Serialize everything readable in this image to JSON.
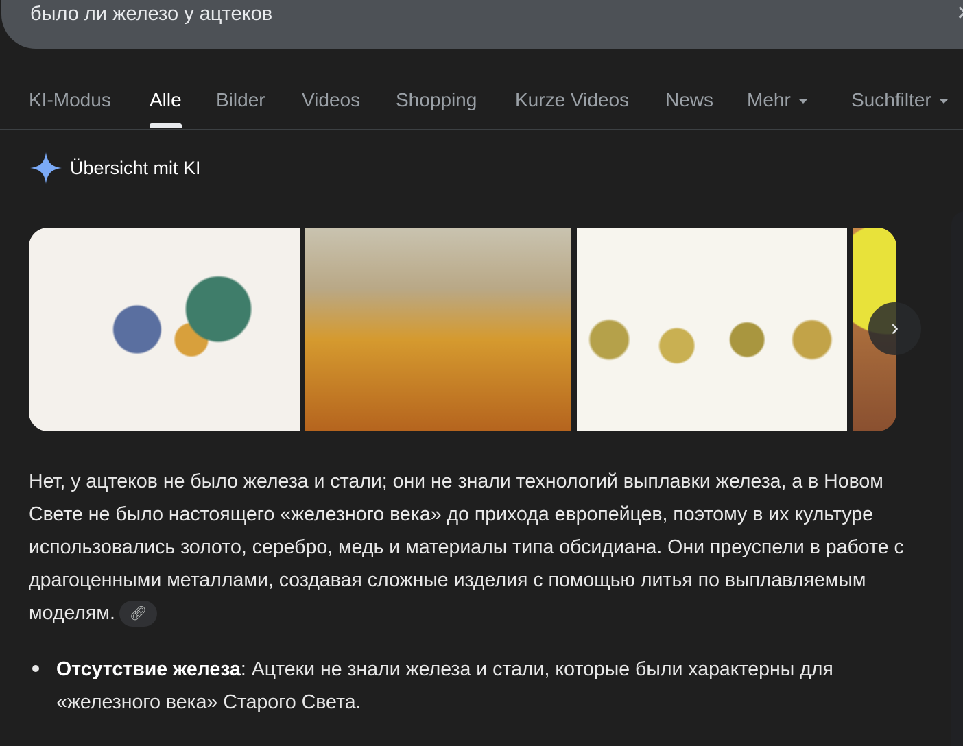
{
  "search": {
    "query": "было ли железо у ацтеков"
  },
  "tabs": [
    {
      "label": "KI-Modus"
    },
    {
      "label": "Alle"
    },
    {
      "label": "Bilder"
    },
    {
      "label": "Videos"
    },
    {
      "label": "Shopping"
    },
    {
      "label": "Kurze Videos"
    },
    {
      "label": "News"
    },
    {
      "label": "Mehr"
    },
    {
      "label": "Suchfilter"
    }
  ],
  "ai_overview": {
    "title": "Übersicht mit KI",
    "paragraph": "Нет, у ацтеков не было железа и стали; они не знали технологий выплавки железа, а в Новом Свете не было настоящего «железного века» до прихода европейцев, поэтому в их культуре использовались золото, серебро, медь и материалы типа обсидиана. Они преуспели в работе с драгоценными металлами, создавая сложные изделия с помощью литья по выплавляемым моделям.",
    "bullets": [
      {
        "title": "Отсутствие железа",
        "text": ": Ацтеки не знали железа и стали, которые были характерны для «железного века» Старого Света."
      }
    ]
  },
  "colors": {
    "accent": "#7baaf7",
    "background": "#1f1f1f"
  }
}
